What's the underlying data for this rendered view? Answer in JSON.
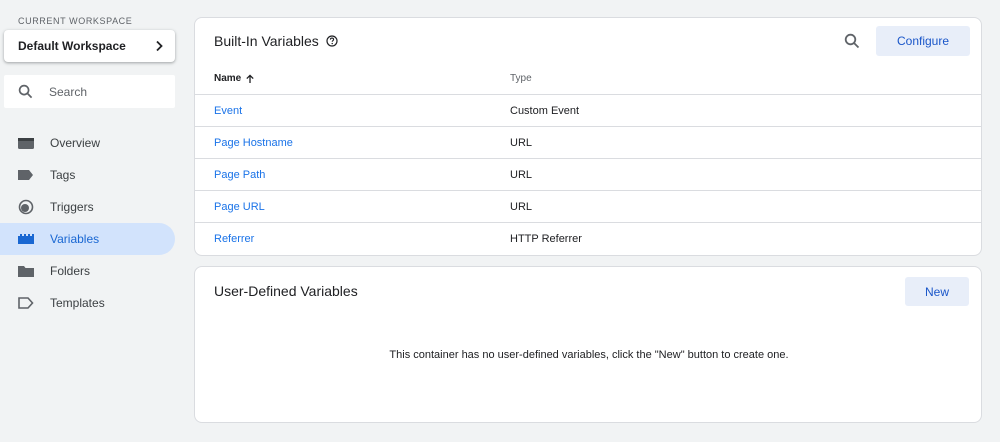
{
  "sidebar": {
    "workspace_label": "CURRENT WORKSPACE",
    "workspace_name": "Default Workspace",
    "search_placeholder": "Search",
    "nav": [
      {
        "label": "Overview",
        "icon": "overview-icon"
      },
      {
        "label": "Tags",
        "icon": "tag-icon"
      },
      {
        "label": "Triggers",
        "icon": "trigger-icon"
      },
      {
        "label": "Variables",
        "icon": "variables-icon",
        "active": true
      },
      {
        "label": "Folders",
        "icon": "folder-icon"
      },
      {
        "label": "Templates",
        "icon": "template-icon"
      }
    ]
  },
  "builtin": {
    "title": "Built-In Variables",
    "configure_label": "Configure",
    "col_name": "Name",
    "col_type": "Type",
    "rows": [
      {
        "name": "Event",
        "type": "Custom Event"
      },
      {
        "name": "Page Hostname",
        "type": "URL"
      },
      {
        "name": "Page Path",
        "type": "URL"
      },
      {
        "name": "Page URL",
        "type": "URL"
      },
      {
        "name": "Referrer",
        "type": "HTTP Referrer"
      }
    ]
  },
  "user_defined": {
    "title": "User-Defined Variables",
    "new_label": "New",
    "empty_message": "This container has no user-defined variables, click the \"New\" button to create one."
  },
  "colors": {
    "accent": "#1a73e8",
    "active_nav_bg": "#d2e3fc",
    "button_bg": "#e8eef9",
    "page_bg": "#f1f3f4"
  }
}
